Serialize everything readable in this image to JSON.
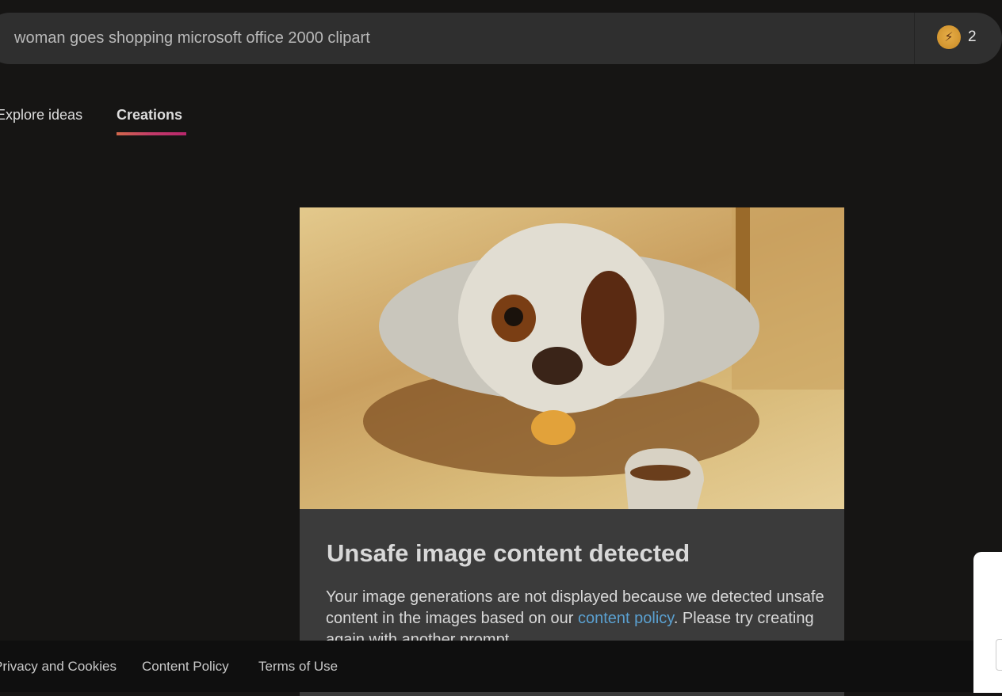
{
  "search": {
    "value": "woman goes shopping microsoft office 2000 clipart"
  },
  "boosts": {
    "icon": "lightning-coin-icon",
    "count": "2"
  },
  "tabs": [
    {
      "label": "Explore ideas"
    },
    {
      "label": "Creations",
      "active": true
    }
  ],
  "card": {
    "title": "Unsafe image content detected",
    "message_before": "Your image generations are not displayed because we detected unsafe content in the images based on our ",
    "link": "content policy",
    "message_after": ". Please try creating again with another prompt."
  },
  "footer": {
    "links": [
      "Privacy and Cookies",
      "Content Policy",
      "Terms of Use"
    ]
  },
  "colors": {
    "accent_gradient": [
      "#d2684c",
      "#b8276c"
    ],
    "link": "#5aa0d0"
  }
}
